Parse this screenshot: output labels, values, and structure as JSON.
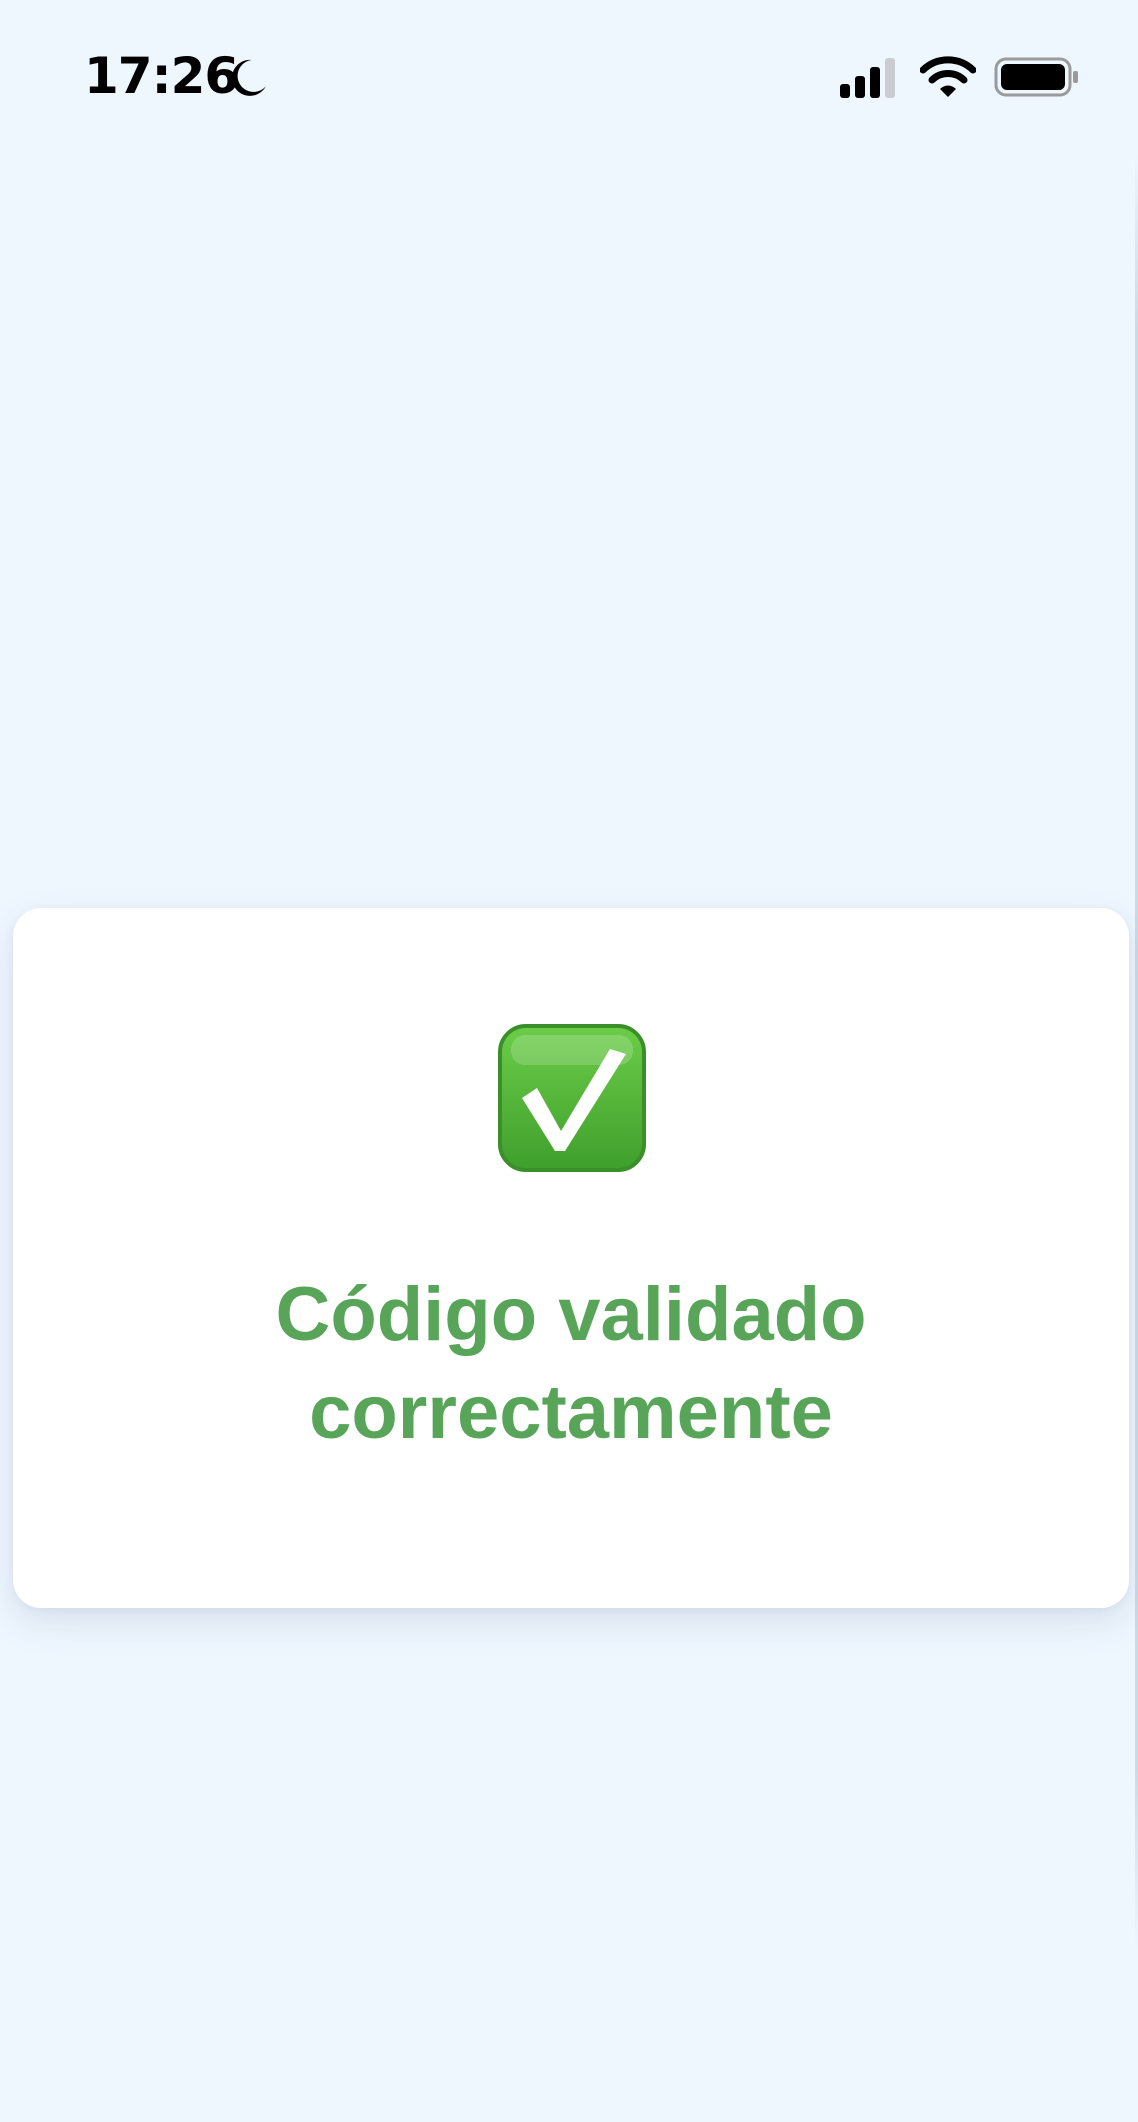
{
  "status_bar": {
    "time": "17:26",
    "focus_icon": "moon-icon",
    "signal_icon": "cellular-signal-icon",
    "wifi_icon": "wifi-icon",
    "battery_icon": "battery-icon",
    "signal_bars_active": 3,
    "signal_bars_total": 4
  },
  "result_card": {
    "icon": "check-mark-button-icon",
    "message_line1": "Código validado",
    "message_line2": "correctamente"
  },
  "colors": {
    "background": "#eef6fe",
    "card": "#ffffff",
    "success_text": "#58a55a",
    "check_green": "#4fb33b"
  }
}
